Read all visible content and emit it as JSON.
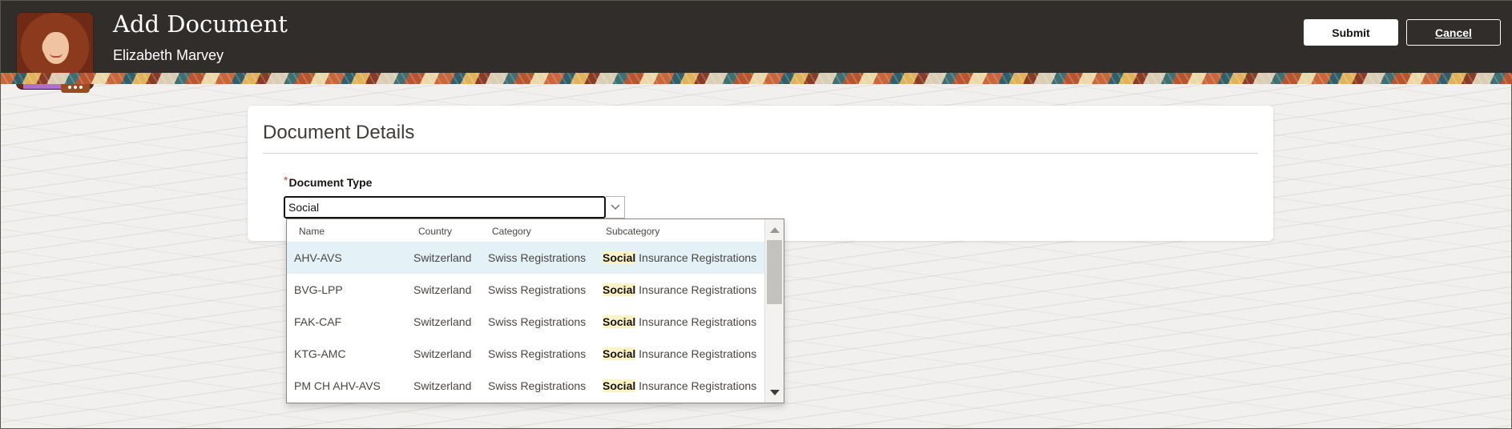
{
  "header": {
    "title": "Add Document",
    "subtitle": "Elizabeth Marvey",
    "submit_label": "Submit",
    "cancel_label": "Cancel"
  },
  "card": {
    "title": "Document Details"
  },
  "field": {
    "required_marker": "*",
    "label": "Document Type",
    "value": "Social"
  },
  "dropdown": {
    "columns": [
      "Name",
      "Country",
      "Category",
      "Subcategory"
    ],
    "match": "Social",
    "rows": [
      {
        "name": "AHV-AVS",
        "country": "Switzerland",
        "category": "Swiss Registrations",
        "sub_rest": " Insurance Registrations"
      },
      {
        "name": "BVG-LPP",
        "country": "Switzerland",
        "category": "Swiss Registrations",
        "sub_rest": " Insurance Registrations"
      },
      {
        "name": "FAK-CAF",
        "country": "Switzerland",
        "category": "Swiss Registrations",
        "sub_rest": " Insurance Registrations"
      },
      {
        "name": "KTG-AMC",
        "country": "Switzerland",
        "category": "Swiss Registrations",
        "sub_rest": " Insurance Registrations"
      },
      {
        "name": "PM CH AHV-AVS",
        "country": "Switzerland",
        "category": "Swiss Registrations",
        "sub_rest": " Insurance Registrations"
      }
    ]
  },
  "icons": {
    "avatar_more": "more-horizontal-icon",
    "combo_toggle": "chevron-down-icon"
  }
}
